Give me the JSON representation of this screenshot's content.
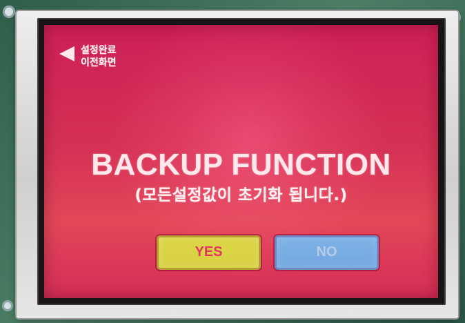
{
  "back_control": {
    "icon": "back-arrow-icon",
    "line1": "설정완료",
    "line2": "이전화면"
  },
  "dialog": {
    "title": "BACKUP FUNCTION",
    "subtitle": "(모든설정값이 초기화 됩니다.)"
  },
  "buttons": {
    "yes_label": "YES",
    "no_label": "NO"
  },
  "colors": {
    "screen_background": "#d53155",
    "yes_button": "#d8d144",
    "no_button": "#73a8df",
    "title_text": "#ffe8ec"
  }
}
